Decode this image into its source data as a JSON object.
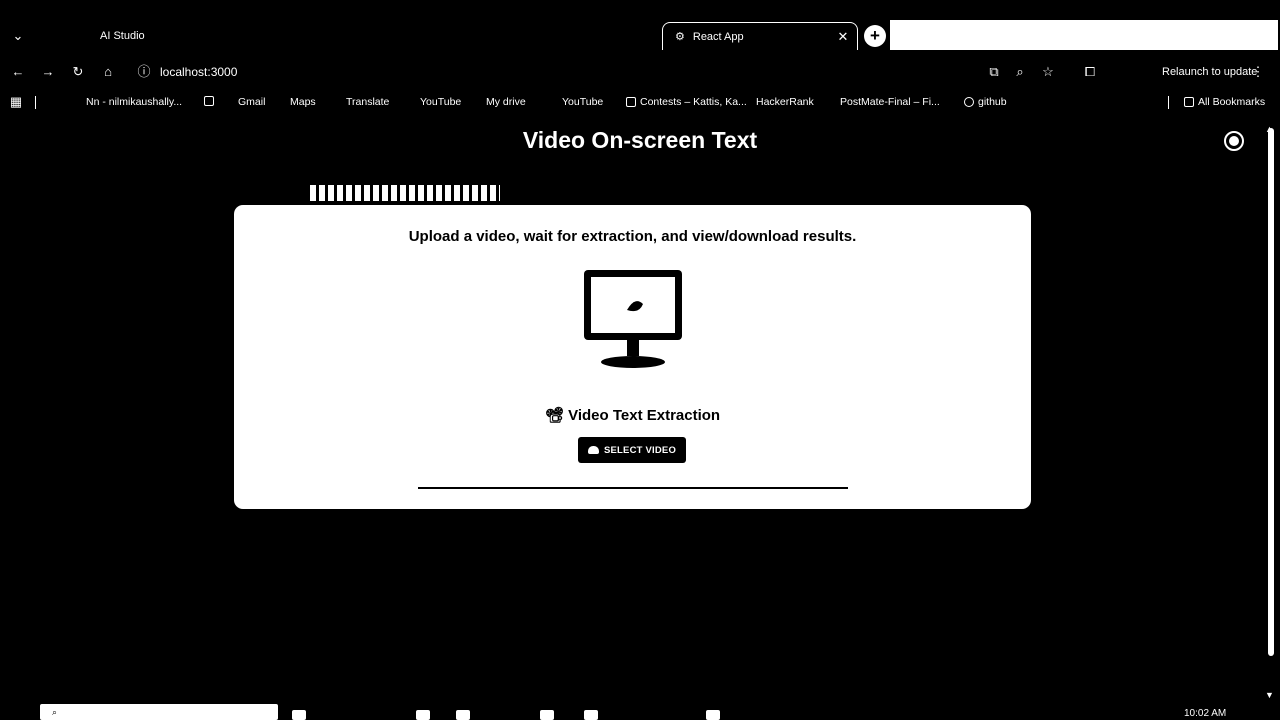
{
  "browser": {
    "tabs": [
      {
        "title": "AI Studio",
        "active": false
      },
      {
        "title": "React App",
        "active": true
      }
    ],
    "url": "localhost:3000",
    "relaunch_label": "Relaunch to update",
    "bookmarks": [
      {
        "label": "Nn - nilmikaushally..."
      },
      {
        "label": "Gmail"
      },
      {
        "label": "Maps"
      },
      {
        "label": "Translate"
      },
      {
        "label": "YouTube"
      },
      {
        "label": "My drive"
      },
      {
        "label": "YouTube"
      },
      {
        "label": "Contests – Kattis, Ka..."
      },
      {
        "label": "HackerRank"
      },
      {
        "label": "PostMate-Final – Fi..."
      },
      {
        "label": "github"
      }
    ],
    "all_bookmarks_label": "All Bookmarks"
  },
  "page": {
    "title": "Video On-screen Text",
    "subtitle": "Upload a video, wait for extraction, and view/download results.",
    "heading": "📽 Video Text Extraction",
    "select_button": "SELECT VIDEO"
  },
  "taskbar": {
    "clock": "10:02 AM"
  }
}
